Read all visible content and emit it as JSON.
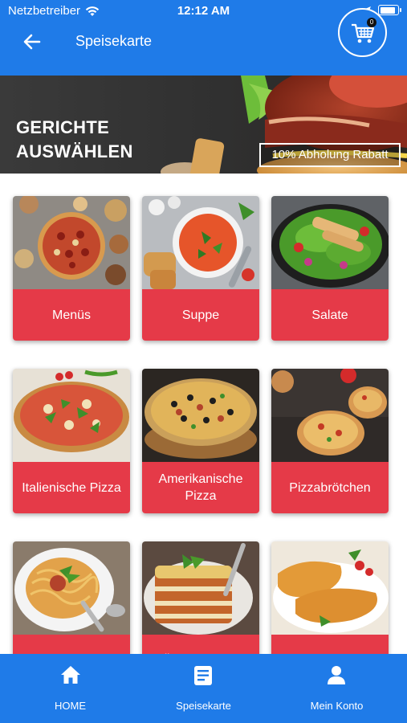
{
  "status_bar": {
    "carrier": "Netzbetreiber",
    "time": "12:12 AM",
    "battery_level": 0.9
  },
  "header": {
    "title": "Speisekarte",
    "cart_count": "0"
  },
  "banner": {
    "headline_line1": "GERICHTE",
    "headline_line2": "AUSWÄHLEN",
    "promo": "10% Abholung Rabatt"
  },
  "categories": [
    {
      "label": "Menüs"
    },
    {
      "label": "Suppe"
    },
    {
      "label": "Salate"
    },
    {
      "label": "Italienische Pizza"
    },
    {
      "label": "Amerikanische Pizza"
    },
    {
      "label": "Pizzabrötchen"
    },
    {
      "label": ""
    },
    {
      "label": "Überbackene"
    },
    {
      "label": ""
    }
  ],
  "bottom_nav": [
    {
      "label": "HOME",
      "icon": "home-icon"
    },
    {
      "label": "Speisekarte",
      "icon": "menu-card-icon"
    },
    {
      "label": "Mein Konto",
      "icon": "account-icon"
    }
  ]
}
